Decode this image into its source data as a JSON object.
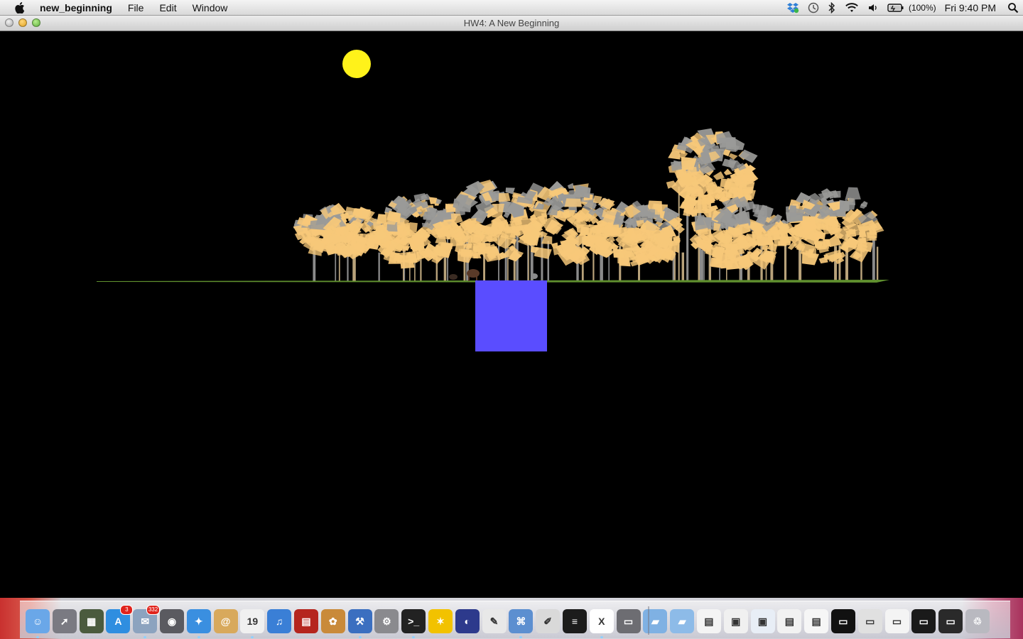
{
  "menubar": {
    "app_name": "new_beginning",
    "menus": [
      "File",
      "Edit",
      "Window"
    ],
    "battery_text": "(100%)",
    "clock": "Fri 9:40 PM"
  },
  "window": {
    "title": "HW4: A New Beginning"
  },
  "colors": {
    "sky": "#000000",
    "sun": "#fff21a",
    "foliage_light": "#f7c879",
    "foliage_gray": "#9a9a98",
    "ground": "#5f8f2e",
    "cube": "#5a4dff"
  },
  "dock": {
    "items": [
      {
        "icon": "finder-icon",
        "bg": "#6aa7e8",
        "glyph": "☺",
        "badge": null,
        "running": true
      },
      {
        "icon": "launchpad-icon",
        "bg": "#7a7a82",
        "glyph": "➚",
        "badge": null,
        "running": false
      },
      {
        "icon": "mission-control-icon",
        "bg": "#4b5b3e",
        "glyph": "▦",
        "badge": null,
        "running": false
      },
      {
        "icon": "app-store-icon",
        "bg": "#2f8ee0",
        "glyph": "A",
        "badge": "3",
        "running": false
      },
      {
        "icon": "mail-icon",
        "bg": "#8ca3bf",
        "glyph": "✉",
        "badge": "332",
        "running": true
      },
      {
        "icon": "facetime-icon",
        "bg": "#5a5a60",
        "glyph": "◉",
        "badge": null,
        "running": false
      },
      {
        "icon": "safari-icon",
        "bg": "#3a8fe0",
        "glyph": "✦",
        "badge": null,
        "running": true
      },
      {
        "icon": "address-book-icon",
        "bg": "#d8a95c",
        "glyph": "@",
        "badge": null,
        "running": false
      },
      {
        "icon": "calendar-icon",
        "bg": "#f0f0f0",
        "glyph": "19",
        "badge": null,
        "running": true
      },
      {
        "icon": "itunes-icon",
        "bg": "#3a7fd6",
        "glyph": "♫",
        "badge": null,
        "running": false
      },
      {
        "icon": "photo-booth-icon",
        "bg": "#b5251e",
        "glyph": "▤",
        "badge": null,
        "running": false
      },
      {
        "icon": "iphoto-icon",
        "bg": "#c98a3a",
        "glyph": "✿",
        "badge": null,
        "running": false
      },
      {
        "icon": "xcode-icon",
        "bg": "#3b6fc0",
        "glyph": "⚒",
        "badge": null,
        "running": true
      },
      {
        "icon": "system-preferences-icon",
        "bg": "#8a8a8e",
        "glyph": "⚙",
        "badge": null,
        "running": false
      },
      {
        "icon": "terminal-icon",
        "bg": "#222222",
        "glyph": ">_",
        "badge": null,
        "running": true
      },
      {
        "icon": "aim-icon",
        "bg": "#f2c200",
        "glyph": "✶",
        "badge": null,
        "running": false
      },
      {
        "icon": "eclipse-icon",
        "bg": "#2d3a8c",
        "glyph": "◐",
        "badge": null,
        "running": false
      },
      {
        "icon": "textedit-icon",
        "bg": "#e8e8e8",
        "glyph": "✎",
        "badge": null,
        "running": false
      },
      {
        "icon": "network-utility-icon",
        "bg": "#5c8fd0",
        "glyph": "⌘",
        "badge": null,
        "running": true
      },
      {
        "icon": "script-editor-icon",
        "bg": "#d9d9d9",
        "glyph": "✐",
        "badge": null,
        "running": false
      },
      {
        "icon": "console-icon",
        "bg": "#1c1c1c",
        "glyph": "≡",
        "badge": null,
        "running": false
      },
      {
        "icon": "x11-icon",
        "bg": "#ffffff",
        "glyph": "X",
        "badge": null,
        "running": true
      },
      {
        "icon": "keyboard-icon",
        "bg": "#6d6d72",
        "glyph": "▭",
        "badge": null,
        "running": false
      },
      {
        "icon": "applications-folder-icon",
        "bg": "#7fb1e3",
        "glyph": "▰",
        "badge": null,
        "running": false
      },
      {
        "icon": "documents-folder-icon",
        "bg": "#8dbbe8",
        "glyph": "▰",
        "badge": null,
        "running": false
      },
      {
        "icon": "downloads-stack-icon",
        "bg": "#f4f4f4",
        "glyph": "▤",
        "badge": null,
        "running": false
      },
      {
        "icon": "minimized-window-1-icon",
        "bg": "#f0f0f0",
        "glyph": "▣",
        "badge": null,
        "running": false
      },
      {
        "icon": "minimized-window-2-icon",
        "bg": "#e8eef6",
        "glyph": "▣",
        "badge": null,
        "running": false
      },
      {
        "icon": "minimized-window-3-icon",
        "bg": "#f2f2f2",
        "glyph": "▤",
        "badge": null,
        "running": false
      },
      {
        "icon": "minimized-window-4-icon",
        "bg": "#f6f6f6",
        "glyph": "▤",
        "badge": null,
        "running": false
      },
      {
        "icon": "minimized-window-5-icon",
        "bg": "#111111",
        "glyph": "▭",
        "badge": null,
        "running": false
      },
      {
        "icon": "minimized-window-6-icon",
        "bg": "#e0e0e0",
        "glyph": "▭",
        "badge": null,
        "running": false
      },
      {
        "icon": "minimized-window-7-icon",
        "bg": "#f4f4f4",
        "glyph": "▭",
        "badge": null,
        "running": false
      },
      {
        "icon": "minimized-window-8-icon",
        "bg": "#1a1a1a",
        "glyph": "▭",
        "badge": null,
        "running": false
      },
      {
        "icon": "minimized-window-9-icon",
        "bg": "#2a2a2a",
        "glyph": "▭",
        "badge": null,
        "running": false
      },
      {
        "icon": "trash-icon",
        "bg": "#b9b9c0",
        "glyph": "♲",
        "badge": null,
        "running": false
      }
    ]
  }
}
